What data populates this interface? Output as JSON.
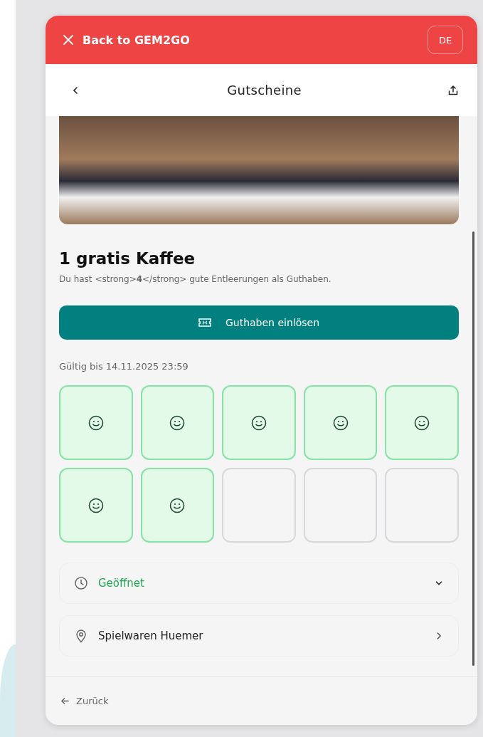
{
  "top_bar": {
    "back_label": "Back to GEM2GO",
    "language": "DE"
  },
  "nav": {
    "title": "Gutscheine"
  },
  "voucher": {
    "title": "1 gratis Kaffee",
    "description": "Du hast <strong>**4**</strong> gute Entleerungen als Guthaben.",
    "redeem_button": "Guthaben einlösen",
    "valid_until": "Gültig bis 14.11.2025 23:59"
  },
  "stamps": [
    {
      "stamped": true
    },
    {
      "stamped": true
    },
    {
      "stamped": true
    },
    {
      "stamped": true
    },
    {
      "stamped": true
    },
    {
      "stamped": true
    },
    {
      "stamped": true
    },
    {
      "stamped": false
    },
    {
      "stamped": false
    },
    {
      "stamped": false
    }
  ],
  "info_rows": [
    {
      "kind": "hours",
      "label": "Geöffnet",
      "expanded": false
    },
    {
      "kind": "location",
      "label": "Spielwaren Huemer"
    }
  ],
  "footer": {
    "back_label": "Zurück"
  }
}
